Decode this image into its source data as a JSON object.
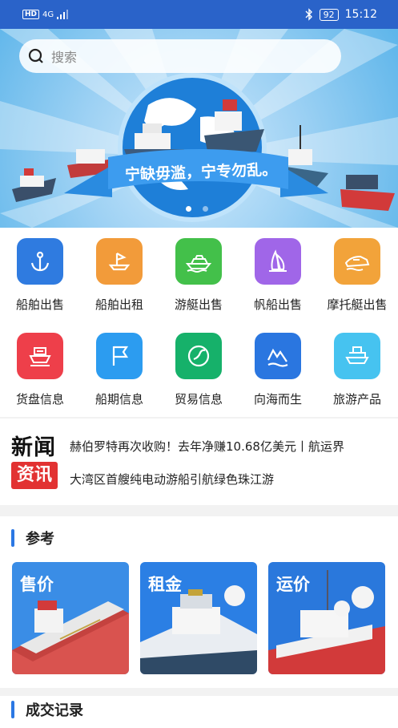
{
  "status_bar": {
    "left_text": "HD",
    "network": "4G",
    "battery": "92",
    "time": "15:12"
  },
  "search": {
    "placeholder": "搜索"
  },
  "banner": {
    "slogan": "宁缺毋滥，宁专勿乱。"
  },
  "grid": [
    {
      "label": "船舶出售",
      "icon": "anchor-icon",
      "color": "#2f7be0"
    },
    {
      "label": "船舶出租",
      "icon": "sailboat-icon",
      "color": "#f29b3a"
    },
    {
      "label": "游艇出售",
      "icon": "yacht-icon",
      "color": "#43c04a"
    },
    {
      "label": "帆船出售",
      "icon": "sail-icon",
      "color": "#a066e8"
    },
    {
      "label": "摩托艇出售",
      "icon": "jetski-icon",
      "color": "#f2a33a"
    },
    {
      "label": "货盘信息",
      "icon": "cargo-ship-icon",
      "color": "#ee3f4a"
    },
    {
      "label": "船期信息",
      "icon": "flag-icon",
      "color": "#2c9cf0"
    },
    {
      "label": "贸易信息",
      "icon": "globe-icon",
      "color": "#16b16a"
    },
    {
      "label": "向海而生",
      "icon": "wave-icon",
      "color": "#2a76e0"
    },
    {
      "label": "旅游产品",
      "icon": "travel-ship-icon",
      "color": "#46c3f0"
    }
  ],
  "news": {
    "title": "新闻",
    "badge": "资讯",
    "items": [
      "赫伯罗特再次收购！去年净赚10.68亿美元丨航运界",
      "大湾区首艘纯电动游船引航绿色珠江游"
    ]
  },
  "reference": {
    "title": "参考",
    "cards": [
      {
        "label": "售价",
        "bg": "#3a8de6"
      },
      {
        "label": "租金",
        "bg": "#2b7fe4"
      },
      {
        "label": "运价",
        "bg": "#2a78dc"
      }
    ]
  },
  "deals": {
    "title": "成交记录"
  },
  "colors": {
    "status_bar": "#2a63c9",
    "accent": "#2b78e4",
    "badge": "#e23232"
  }
}
